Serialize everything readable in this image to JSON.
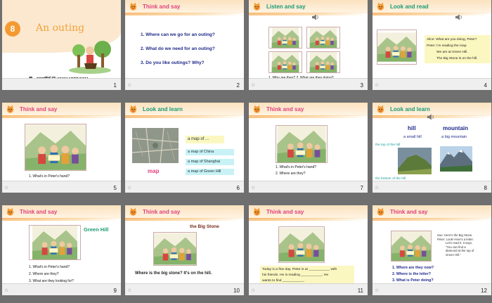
{
  "colors": {
    "accent_pink": "#e0407c",
    "question_blue": "#1f2a8a",
    "orange": "#f49a32"
  },
  "slides": [
    {
      "num": "1",
      "unit": "8",
      "title": "An outing",
      "footer_text": "第一PPT模板网-WWW.1PPT.COM"
    },
    {
      "num": "2",
      "title": "Think and say",
      "questions": [
        "1. Where can we go for an outing?",
        "2. What do we need for an outing?",
        "3. Do you like outings? Why?"
      ]
    },
    {
      "num": "3",
      "title": "Listen and say",
      "caption": "1. Who are they?    2. What are they doing?"
    },
    {
      "num": "4",
      "title": "Look and read",
      "dialog": [
        "Alice: What are you doing, Peter?",
        "Peter: I'm reading the map.",
        "We are at Green Hill.",
        "The Big Stone is on the hill."
      ]
    },
    {
      "num": "5",
      "title": "Think and say",
      "questions": [
        "1. What's in Peter's hand?"
      ]
    },
    {
      "num": "6",
      "title": "Look and learn",
      "label_map": "map",
      "title_box": "a map of ...",
      "items": [
        "a map of China",
        "a map of Shanghai",
        "a map of Green Hill"
      ]
    },
    {
      "num": "7",
      "title": "Think and say",
      "questions": [
        "1. What's in Peter's hand?",
        "2. Where are they?"
      ]
    },
    {
      "num": "8",
      "title": "Look and learn",
      "hill": "hill",
      "hill_sub": "a small hill",
      "mountain": "mountain",
      "mountain_sub": "a big mountain",
      "top_label": "the top of the hill",
      "bottom_label": "the bottom of the hill"
    },
    {
      "num": "9",
      "title": "Think and say",
      "label": "Green Hill",
      "questions": [
        "1. What's in Peter's hand?",
        "2. Where are they?",
        "3. What are they looking for?"
      ]
    },
    {
      "num": "10",
      "title": "Think and say",
      "label": "the Big Stone",
      "sentence": "Where is the big stone?    It's on the hill."
    },
    {
      "num": "11",
      "title": "Think and say",
      "lines": [
        "Today is a fine day. Peter is at ___________ with",
        "his friends. He is reading ___________. He",
        "wants to find ___________."
      ]
    },
    {
      "num": "12",
      "title": "Think and say",
      "side": [
        "Sue: Here's the Big Stone.",
        "Peter: Look! Here's a letter.",
        "Let's read it. It says,",
        "\"You can find a",
        "diamond at the top of",
        "Green Hill.\""
      ],
      "questions": [
        "1. Where are they now?",
        "2. Where is the letter?",
        "3. What is Peter doing?"
      ]
    }
  ]
}
